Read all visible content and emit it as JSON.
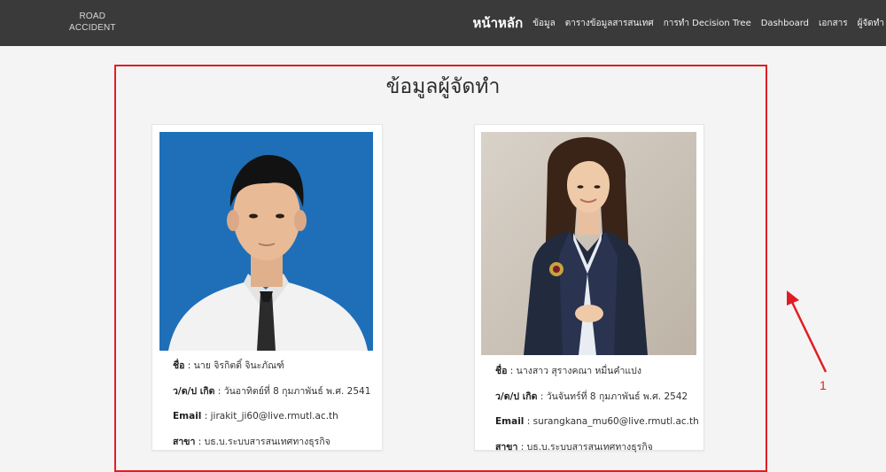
{
  "brand": {
    "line1": "ROAD",
    "line2": "ACCIDENT"
  },
  "nav": {
    "items": [
      {
        "label": "หน้าหลัก",
        "active": true
      },
      {
        "label": "ข้อมูล"
      },
      {
        "label": "ตารางข้อมูลสารสนเทศ"
      },
      {
        "label": "การทำ Decision Tree"
      },
      {
        "label": "Dashboard"
      },
      {
        "label": "เอกสาร"
      },
      {
        "label": "ผู้จัดทำ"
      }
    ]
  },
  "page": {
    "title": "ข้อมูลผู้จัดทำ"
  },
  "authors": [
    {
      "name_label": "ชื่อ",
      "name": " : นาย จิรกิตติ์ จินะภัณฑ์",
      "dob_label": "ว/ด/ป เกิด",
      "dob": " : วันอาทิตย์ที่ 8 กุมภาพันธ์ พ.ศ. 2541",
      "email_label": "Email",
      "email": " : jirakit_ji60@live.rmutl.ac.th",
      "major_label": "สาขา",
      "major": " : บธ.บ.ระบบสารสนเทศทางธุรกิจ"
    },
    {
      "name_label": "ชื่อ",
      "name": " : นางสาว สุรางคณา หมื่นคำแปง",
      "dob_label": "ว/ด/ป เกิด",
      "dob": " : วันจันทร์ที่ 8 กุมภาพันธ์ พ.ศ. 2542",
      "email_label": "Email",
      "email": " : surangkana_mu60@live.rmutl.ac.th",
      "major_label": "สาขา",
      "major": " : บธ.บ.ระบบสารสนเทศทางธุรกิจ"
    }
  ],
  "annotation": {
    "label": "1",
    "color": "#e11d24"
  },
  "colors": {
    "topbar": "#3a3a3a",
    "background": "#f4f4f4",
    "photo1_bg": "#1e6fb8"
  }
}
